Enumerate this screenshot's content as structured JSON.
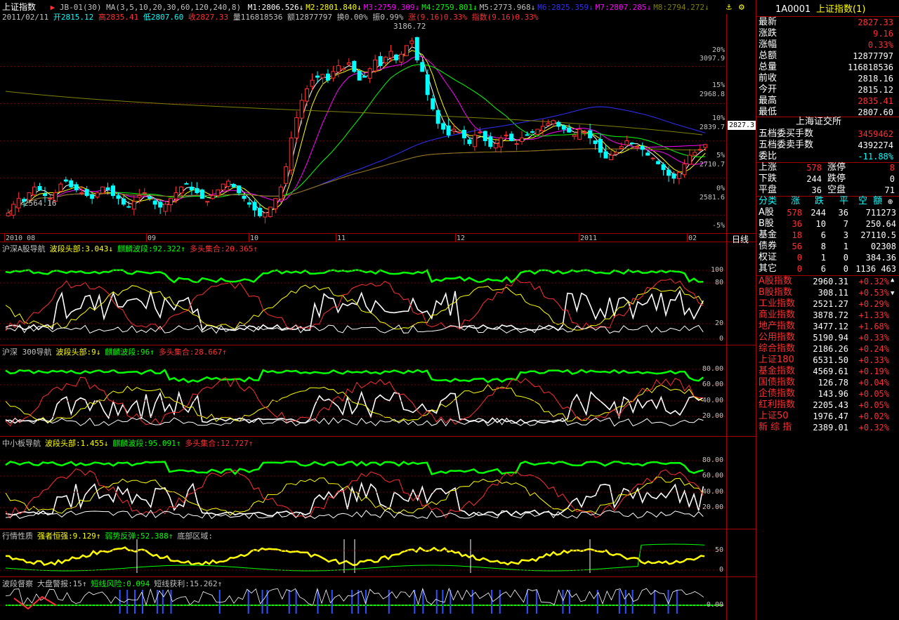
{
  "header": {
    "title": "上证指数",
    "indicator_line": "JB-01(30) MA(3,5,10,20,30,60,120,240,8)",
    "ma": [
      {
        "label": "M1:2806.526",
        "color": "#ffffff"
      },
      {
        "label": "M2:2801.840",
        "color": "#ffff00"
      },
      {
        "label": "M3:2759.309",
        "color": "#ff00ff"
      },
      {
        "label": "M4:2759.801",
        "color": "#00ff00"
      },
      {
        "label": "M5:2773.968",
        "color": "#c0c0c0"
      },
      {
        "label": "M6:2825.359",
        "color": "#3030ff"
      },
      {
        "label": "M7:2807.285",
        "color": "#ff00ff"
      },
      {
        "label": "M8:2794.272",
        "color": "#808000"
      }
    ],
    "date": "2011/02/11",
    "open": "开2815.12",
    "high": "高2835.41",
    "low": "低2807.60",
    "close": "收2827.33",
    "volume": "量116818536",
    "amount": "额12877797",
    "turnover": "换0.00%",
    "amplitude": "振0.99%",
    "change": "涨(9.16)0.33%",
    "index_change": "指数(9.16)0.33%"
  },
  "main_chart": {
    "price_peak_label": "3186.72",
    "price_low_label": "2564.16",
    "current_price_tag": "2827.3",
    "right_axis": [
      "20%",
      "3097.9",
      "15%",
      "2968.8",
      "10%",
      "2839.7",
      "5%",
      "2710.7",
      "0%",
      "2581.6",
      "-5%"
    ],
    "x_axis": [
      "2010 08",
      "09",
      "10",
      "11",
      "12",
      "2011",
      "02"
    ],
    "period": "日线"
  },
  "panels": [
    {
      "name": "沪深A股导航",
      "labels": [
        {
          "text": "波段头部:3.043↓",
          "color": "#ffff00"
        },
        {
          "text": "麒麟波段:92.322↑",
          "color": "#00ff00"
        },
        {
          "text": "多头集合:20.365↑",
          "color": "#ff3030"
        }
      ],
      "axis": [
        "100",
        "80",
        "20",
        "0"
      ]
    },
    {
      "name": "沪深 300导航",
      "labels": [
        {
          "text": "波段头部:9↓",
          "color": "#ffff00"
        },
        {
          "text": "麒麟波段:96↑",
          "color": "#00ff00"
        },
        {
          "text": "多头集合:28.667↑",
          "color": "#ff3030"
        }
      ],
      "axis": [
        "80.00",
        "60.00",
        "40.00",
        "20.00"
      ]
    },
    {
      "name": "中小板导航",
      "labels": [
        {
          "text": "波段头部:1.455↓",
          "color": "#ffff00"
        },
        {
          "text": "麒麟波段:95.091↑",
          "color": "#00ff00"
        },
        {
          "text": "多头集合:12.727↑",
          "color": "#ff3030"
        }
      ],
      "axis": [
        "80.00",
        "60.00",
        "40.00",
        "20.00"
      ]
    },
    {
      "name": "行情性质",
      "labels": [
        {
          "text": "强者恒强:9.129↑",
          "color": "#ffff00"
        },
        {
          "text": "弱势反弹:52.388↑",
          "color": "#00ff00"
        },
        {
          "text": "底部区域:",
          "color": "#c0c0c0"
        }
      ],
      "axis": [
        "50",
        "0"
      ]
    },
    {
      "name": "波段督察",
      "labels": [
        {
          "text": "大盘警报:15↑",
          "color": "#c0c0c0"
        },
        {
          "text": "短线风险:0.094",
          "color": "#00ff00"
        },
        {
          "text": "短线获利:15.262↑",
          "color": "#c0c0c0"
        }
      ],
      "axis": [
        "0.00"
      ]
    }
  ],
  "right_panel": {
    "code": "1A0001",
    "name": "上证指数(1)",
    "quote": [
      {
        "label": "最新",
        "value": "2827.33",
        "color": "#ff3030"
      },
      {
        "label": "涨跌",
        "value": "9.16",
        "color": "#ff3030"
      },
      {
        "label": "涨幅",
        "value": "0.33%",
        "color": "#ff3030"
      },
      {
        "label": "总额",
        "value": "12877797",
        "color": "#ffffff"
      },
      {
        "label": "总量",
        "value": "116818536",
        "color": "#ffffff"
      },
      {
        "label": "前收",
        "value": "2818.16",
        "color": "#ffffff"
      },
      {
        "label": "今开",
        "value": "2815.12",
        "color": "#ffffff"
      },
      {
        "label": "最高",
        "value": "2835.41",
        "color": "#ff3030"
      },
      {
        "label": "最低",
        "value": "2807.60",
        "color": "#ffffff"
      }
    ],
    "exchange": "上海证交所",
    "orders": [
      {
        "label": "五档委买手数",
        "value": "3459462",
        "color": "#ff3030"
      },
      {
        "label": "五档委卖手数",
        "value": "4392274",
        "color": "#ffffff"
      },
      {
        "label": "委比",
        "value": "-11.88%",
        "color": "#00ffff"
      }
    ],
    "breadth": [
      {
        "l1": "上涨",
        "v1": "578",
        "c1": "#ff3030",
        "l2": "涨停",
        "v2": "8",
        "c2": "#ff3030"
      },
      {
        "l1": "下跌",
        "v1": "244",
        "c1": "#ffffff",
        "l2": "跌停",
        "v2": "0",
        "c2": "#ffffff"
      },
      {
        "l1": "平盘",
        "v1": "36",
        "c1": "#ffffff",
        "l2": "空盘",
        "v2": "71",
        "c2": "#ffffff"
      }
    ],
    "class_header": [
      "分类",
      "涨",
      "跌",
      "平",
      "空",
      "额"
    ],
    "classes": [
      {
        "name": "A股",
        "up": "578",
        "down": "244",
        "flat": "36",
        "amt": "711273"
      },
      {
        "name": "B股",
        "up": "36",
        "down": "10",
        "flat": "7",
        "amt": "250.64"
      },
      {
        "name": "基金",
        "up": "18",
        "down": "6",
        "flat": "3",
        "amt": "27110.5"
      },
      {
        "name": "债券",
        "up": "56",
        "down": "8",
        "flat": "1",
        "amt": "02308"
      },
      {
        "name": "权证",
        "up": "0",
        "down": "1",
        "flat": "0",
        "amt": "384.36"
      },
      {
        "name": "其它",
        "up": "0",
        "down": "6",
        "flat": "0",
        "amt": "1136 463"
      }
    ],
    "indices": [
      {
        "name": "A股指数",
        "value": "2960.31",
        "pct": "+0.32%"
      },
      {
        "name": "B股指数",
        "value": "308.11",
        "pct": "+0.53%"
      },
      {
        "name": "工业指数",
        "value": "2521.27",
        "pct": "+0.29%"
      },
      {
        "name": "商业指数",
        "value": "3878.72",
        "pct": "+1.33%"
      },
      {
        "name": "地产指数",
        "value": "3477.12",
        "pct": "+1.68%"
      },
      {
        "name": "公用指数",
        "value": "5190.94",
        "pct": "+0.33%"
      },
      {
        "name": "综合指数",
        "value": "2186.26",
        "pct": "+0.24%"
      },
      {
        "name": "上证180",
        "value": "6531.50",
        "pct": "+0.33%"
      },
      {
        "name": "基金指数",
        "value": "4569.61",
        "pct": "+0.19%"
      },
      {
        "name": "国债指数",
        "value": "126.78",
        "pct": "+0.04%"
      },
      {
        "name": "企债指数",
        "value": "143.96",
        "pct": "+0.05%"
      },
      {
        "name": "红利指数",
        "value": "2205.43",
        "pct": "+0.05%"
      },
      {
        "name": "上证50",
        "value": "1976.47",
        "pct": "+0.02%"
      },
      {
        "name": "新 综 指",
        "value": "2389.01",
        "pct": "+0.32%"
      }
    ]
  },
  "chart_data": {
    "type": "candlestick",
    "ylim": [
      2520,
      3250
    ],
    "y_ticks": [
      2581.6,
      2710.7,
      2839.7,
      2968.8,
      3097.9
    ],
    "x_ticks": [
      "2010 08",
      "09",
      "10",
      "11",
      "12",
      "2011",
      "02"
    ],
    "close": [
      2590,
      2620,
      2640,
      2630,
      2660,
      2680,
      2670,
      2650,
      2640,
      2660,
      2690,
      2700,
      2680,
      2670,
      2660,
      2650,
      2640,
      2660,
      2680,
      2670,
      2650,
      2640,
      2620,
      2610,
      2630,
      2650,
      2660,
      2640,
      2620,
      2610,
      2620,
      2640,
      2660,
      2680,
      2690,
      2670,
      2660,
      2640,
      2630,
      2650,
      2670,
      2690,
      2700,
      2680,
      2660,
      2640,
      2620,
      2600,
      2580,
      2590,
      2610,
      2640,
      2680,
      2750,
      2850,
      2920,
      2980,
      3020,
      3050,
      3060,
      3070,
      3050,
      3080,
      3100,
      3090,
      3110,
      3080,
      3050,
      3060,
      3090,
      3120,
      3100,
      3130,
      3150,
      3120,
      3140,
      3170,
      3186,
      3120,
      3080,
      3000,
      2950,
      2900,
      2880,
      2860,
      2880,
      2870,
      2850,
      2830,
      2860,
      2870,
      2840,
      2820,
      2830,
      2850,
      2860,
      2840,
      2830,
      2850,
      2860,
      2870,
      2880,
      2890,
      2900,
      2910,
      2890,
      2880,
      2870,
      2860,
      2880,
      2870,
      2850,
      2830,
      2800,
      2780,
      2790,
      2800,
      2820,
      2840,
      2830,
      2820,
      2810,
      2790,
      2780,
      2760,
      2740,
      2720,
      2710,
      2730,
      2760,
      2790,
      2800,
      2810,
      2827
    ]
  }
}
